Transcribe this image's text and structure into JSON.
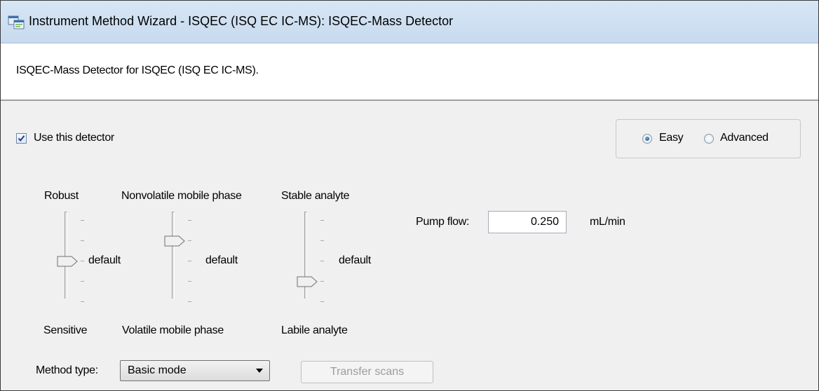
{
  "window": {
    "title": "Instrument Method Wizard - ISQEC (ISQ EC IC-MS): ISQEC-Mass Detector",
    "app_icon": "wizard-app-icon"
  },
  "description": "ISQEC-Mass Detector for ISQEC (ISQ EC IC-MS).",
  "use_detector": {
    "label": "Use this detector",
    "checked": true
  },
  "mode": {
    "options": [
      {
        "label": "Easy",
        "selected": true
      },
      {
        "label": "Advanced",
        "selected": false
      }
    ]
  },
  "sliders": [
    {
      "top_label": "Robust",
      "bottom_label": "Sensitive",
      "value_label": "default",
      "position_index": 2,
      "positions": 5
    },
    {
      "top_label": "Nonvolatile mobile phase",
      "bottom_label": "Volatile mobile phase",
      "value_label": "default",
      "position_index": 1,
      "positions": 5
    },
    {
      "top_label": "Stable analyte",
      "bottom_label": "Labile analyte",
      "value_label": "default",
      "position_index": 3,
      "positions": 5
    }
  ],
  "pump_flow": {
    "label": "Pump flow:",
    "value": "0.250",
    "unit": "mL/min"
  },
  "method_type": {
    "label": "Method type:",
    "selected": "Basic mode"
  },
  "transfer_scans": {
    "label": "Transfer scans",
    "enabled": false
  },
  "colors": {
    "titlebar": "#c7daee",
    "accent": "#1a4f8c",
    "disabled_text": "#9c9c9c"
  }
}
